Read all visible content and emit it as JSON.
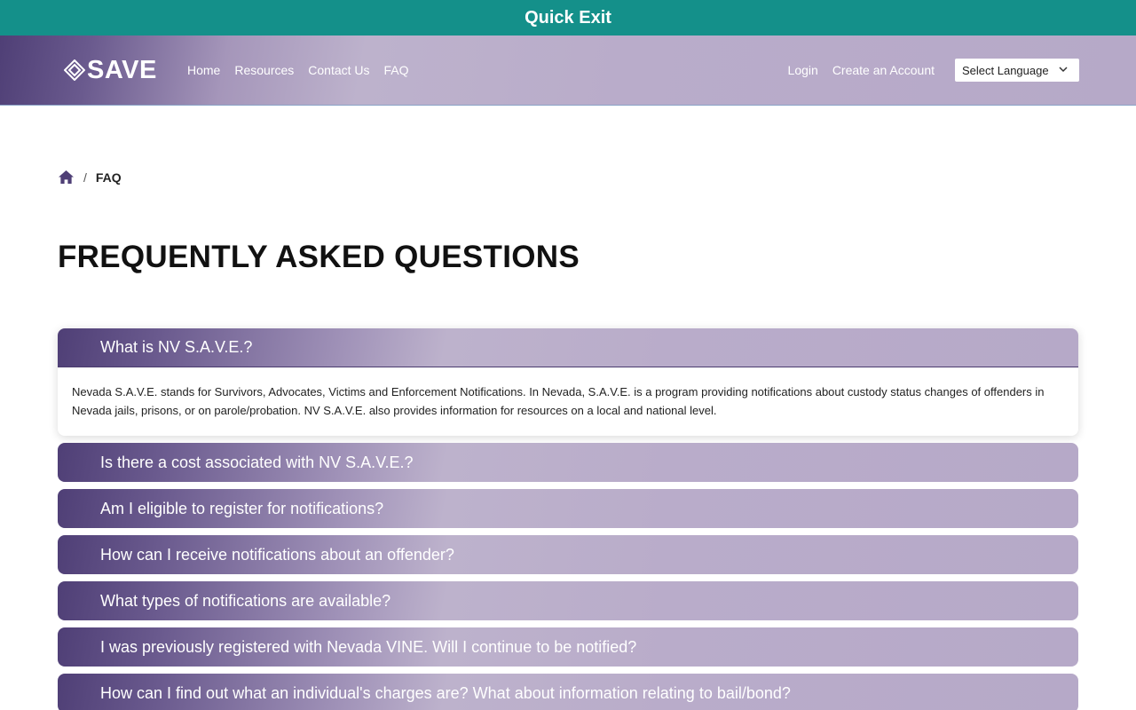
{
  "quick_exit": "Quick Exit",
  "brand": {
    "name": "SAVE"
  },
  "nav": {
    "links": [
      "Home",
      "Resources",
      "Contact Us",
      "FAQ"
    ],
    "login": "Login",
    "create_account": "Create an Account",
    "language": "Select Language"
  },
  "breadcrumb": {
    "current": "FAQ",
    "separator": "/"
  },
  "page_title": "FREQUENTLY ASKED QUESTIONS",
  "faq": [
    {
      "question": "What is NV S.A.V.E.?",
      "answer": "Nevada S.A.V.E. stands for Survivors, Advocates, Victims and Enforcement Notifications. In Nevada, S.A.V.E. is a program providing notifications about custody status changes of offenders in Nevada jails, prisons, or on parole/probation. NV S.A.V.E. also provides information for resources on a local and national level.",
      "expanded": true
    },
    {
      "question": "Is there a cost associated with NV S.A.V.E.?",
      "expanded": false
    },
    {
      "question": "Am I eligible to register for notifications?",
      "expanded": false
    },
    {
      "question": "How can I receive notifications about an offender?",
      "expanded": false
    },
    {
      "question": "What types of notifications are available?",
      "expanded": false
    },
    {
      "question": "I was previously registered with Nevada VINE. Will I continue to be notified?",
      "expanded": false
    },
    {
      "question": "How can I find out what an individual's charges are? What about information relating to bail/bond?",
      "expanded": false
    }
  ],
  "colors": {
    "quick_exit_bg": "#14908a",
    "brand_purple": "#4f3f76",
    "brand_lavender": "#bdb2cc"
  },
  "icons": [
    "diamond-logo-icon",
    "chevron-down-icon",
    "home-icon"
  ]
}
